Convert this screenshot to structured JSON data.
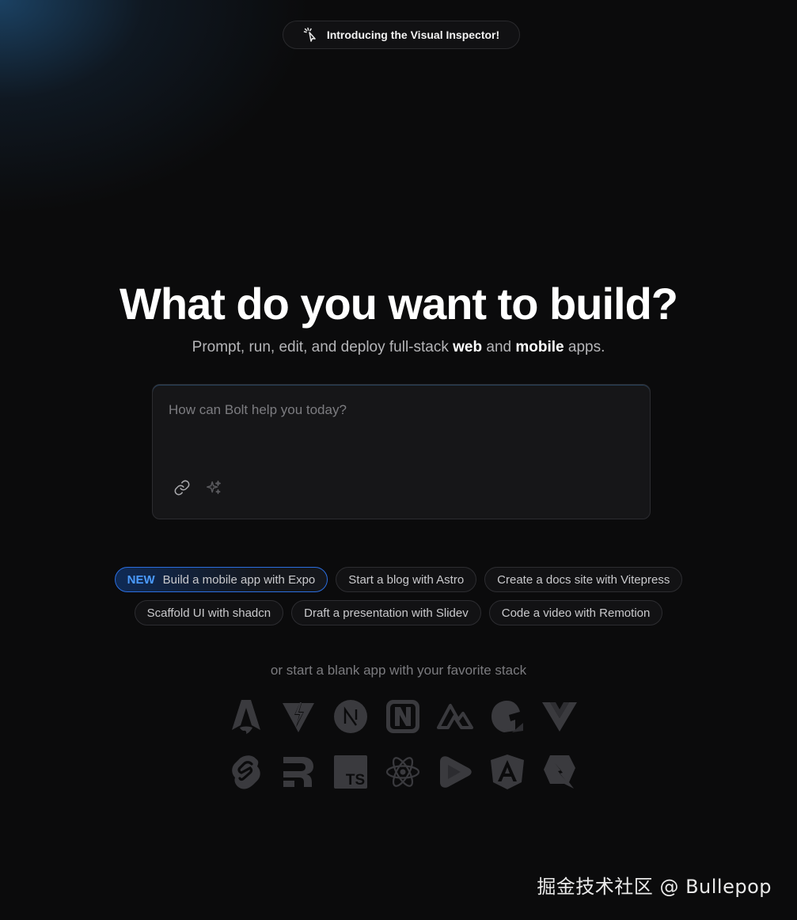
{
  "announcement": {
    "label": "Introducing the Visual Inspector!",
    "icon": "cursor-click-icon"
  },
  "hero": {
    "title": "What do you want to build?",
    "subtitle_prefix": "Prompt, run, edit, and deploy full-stack ",
    "subtitle_web": "web",
    "subtitle_and": " and ",
    "subtitle_mobile": "mobile",
    "subtitle_suffix": " apps."
  },
  "prompt": {
    "placeholder": "How can Bolt help you today?",
    "value": "",
    "tools": [
      {
        "name": "attach-link-icon"
      },
      {
        "name": "enhance-sparkle-icon"
      }
    ]
  },
  "suggestions": {
    "row1": [
      {
        "tag": "NEW",
        "label": "Build a mobile app with Expo",
        "featured": true
      },
      {
        "label": "Start a blog with Astro"
      },
      {
        "label": "Create a docs site with Vitepress"
      }
    ],
    "row2": [
      {
        "label": "Scaffold UI with shadcn"
      },
      {
        "label": "Draft a presentation with Slidev"
      },
      {
        "label": "Code a video with Remotion"
      }
    ]
  },
  "blank_app": {
    "label": "or start a blank app with your favorite stack",
    "row1": [
      "astro-icon",
      "vite-icon",
      "nextjs-icon",
      "nuxt-n-icon",
      "nuxt-icon",
      "gatsby-icon",
      "vue-icon"
    ],
    "row2": [
      "svelte-icon",
      "remix-icon",
      "typescript-icon",
      "react-icon",
      "slidev-icon",
      "angular-icon",
      "qwik-icon"
    ],
    "typescript_text": "TS"
  },
  "watermark": {
    "text": "掘金技术社区 @ Bullepop"
  },
  "colors": {
    "background": "#0b0b0c",
    "accent": "#4b9bff",
    "icon_gray": "#3c3c40"
  }
}
